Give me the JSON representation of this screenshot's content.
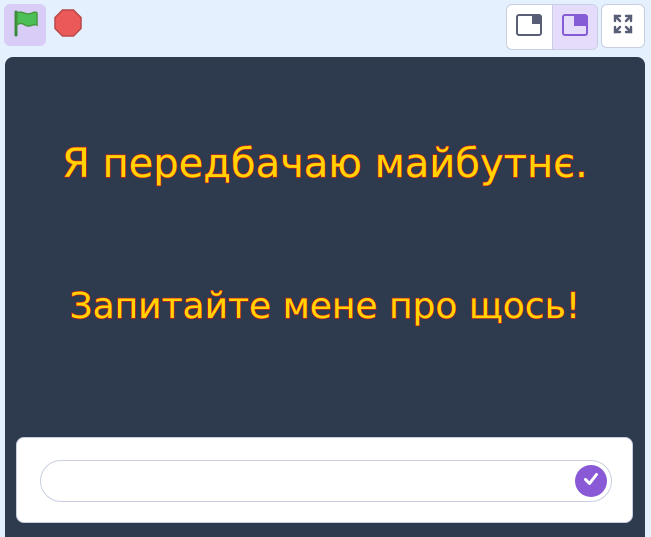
{
  "toolbar": {
    "green_flag_icon": "green-flag-icon",
    "stop_icon": "stop-icon",
    "small_stage_icon": "small-stage-layout-icon",
    "normal_stage_icon": "normal-stage-layout-icon",
    "fullscreen_icon": "fullscreen-icon",
    "active_layout": "normal"
  },
  "stage": {
    "line1": "Я передбачаю майбутнє.",
    "line2": "Запитайте мене про щось!",
    "text_color": "#ffd400",
    "text_outline_color": "#e8231c",
    "background_color": "#2e3a4e"
  },
  "ask": {
    "value": "",
    "submit_icon": "checkmark-icon",
    "accent_color": "#8a5ad6"
  }
}
